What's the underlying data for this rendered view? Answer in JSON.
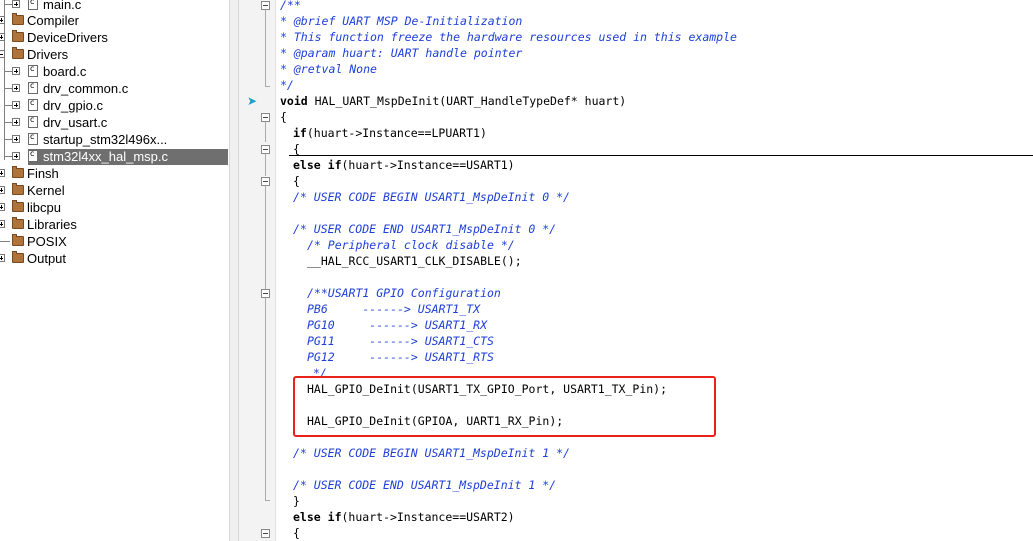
{
  "project_tree": {
    "items": [
      {
        "label": "main.c",
        "type": "file"
      },
      {
        "label": "Compiler",
        "type": "folder"
      },
      {
        "label": "DeviceDrivers",
        "type": "folder"
      },
      {
        "label": "Drivers",
        "type": "folder",
        "expanded": true
      },
      {
        "label": "board.c",
        "type": "file"
      },
      {
        "label": "drv_common.c",
        "type": "file"
      },
      {
        "label": "drv_gpio.c",
        "type": "file"
      },
      {
        "label": "drv_usart.c",
        "type": "file"
      },
      {
        "label": "startup_stm32l496x...",
        "type": "file"
      },
      {
        "label": "stm32l4xx_hal_msp.c",
        "type": "file",
        "selected": true
      },
      {
        "label": "Finsh",
        "type": "folder"
      },
      {
        "label": "Kernel",
        "type": "folder"
      },
      {
        "label": "libcpu",
        "type": "folder"
      },
      {
        "label": "Libraries",
        "type": "folder"
      },
      {
        "label": "POSIX",
        "type": "folder"
      },
      {
        "label": "Output",
        "type": "folder"
      }
    ]
  },
  "editor": {
    "lines": [
      "/**",
      "* @brief UART MSP De-Initialization",
      "* This function freeze the hardware resources used in this example",
      "* @param huart: UART handle pointer",
      "* @retval None",
      "*/",
      "void HAL_UART_MspDeInit(UART_HandleTypeDef* huart)",
      "{",
      "if(huart->Instance==LPUART1)",
      "{",
      "else if(huart->Instance==USART1)",
      "{",
      "/* USER CODE BEGIN USART1_MspDeInit 0 */",
      "/* USER CODE END USART1_MspDeInit 0 */",
      "/* Peripheral clock disable */",
      "__HAL_RCC_USART1_CLK_DISABLE();",
      "/**USART1 GPIO Configuration",
      "PB6     ------> USART1_TX",
      "PG10     ------> USART1_RX",
      "PG11     ------> USART1_CTS",
      "PG12     ------> USART1_RTS",
      "*/",
      "HAL_GPIO_DeInit(USART1_TX_GPIO_Port, USART1_TX_Pin);",
      "HAL_GPIO_DeInit(GPIOA, UART1_RX_Pin);",
      "/* USER CODE BEGIN USART1_MspDeInit 1 */",
      "/* USER CODE END USART1_MspDeInit 1 */",
      "}",
      "else if(huart->Instance==USART2)",
      "{"
    ]
  },
  "colors": {
    "comment": "#1d3fd8",
    "highlight_box": "#e8221a",
    "selection": "#6f6f6f",
    "folder": "#b0733a"
  },
  "icons": {
    "folder": "folder-icon",
    "file": "c-file-icon",
    "expander": "plus-expander-icon",
    "bookmark": "current-line-arrow-icon"
  }
}
